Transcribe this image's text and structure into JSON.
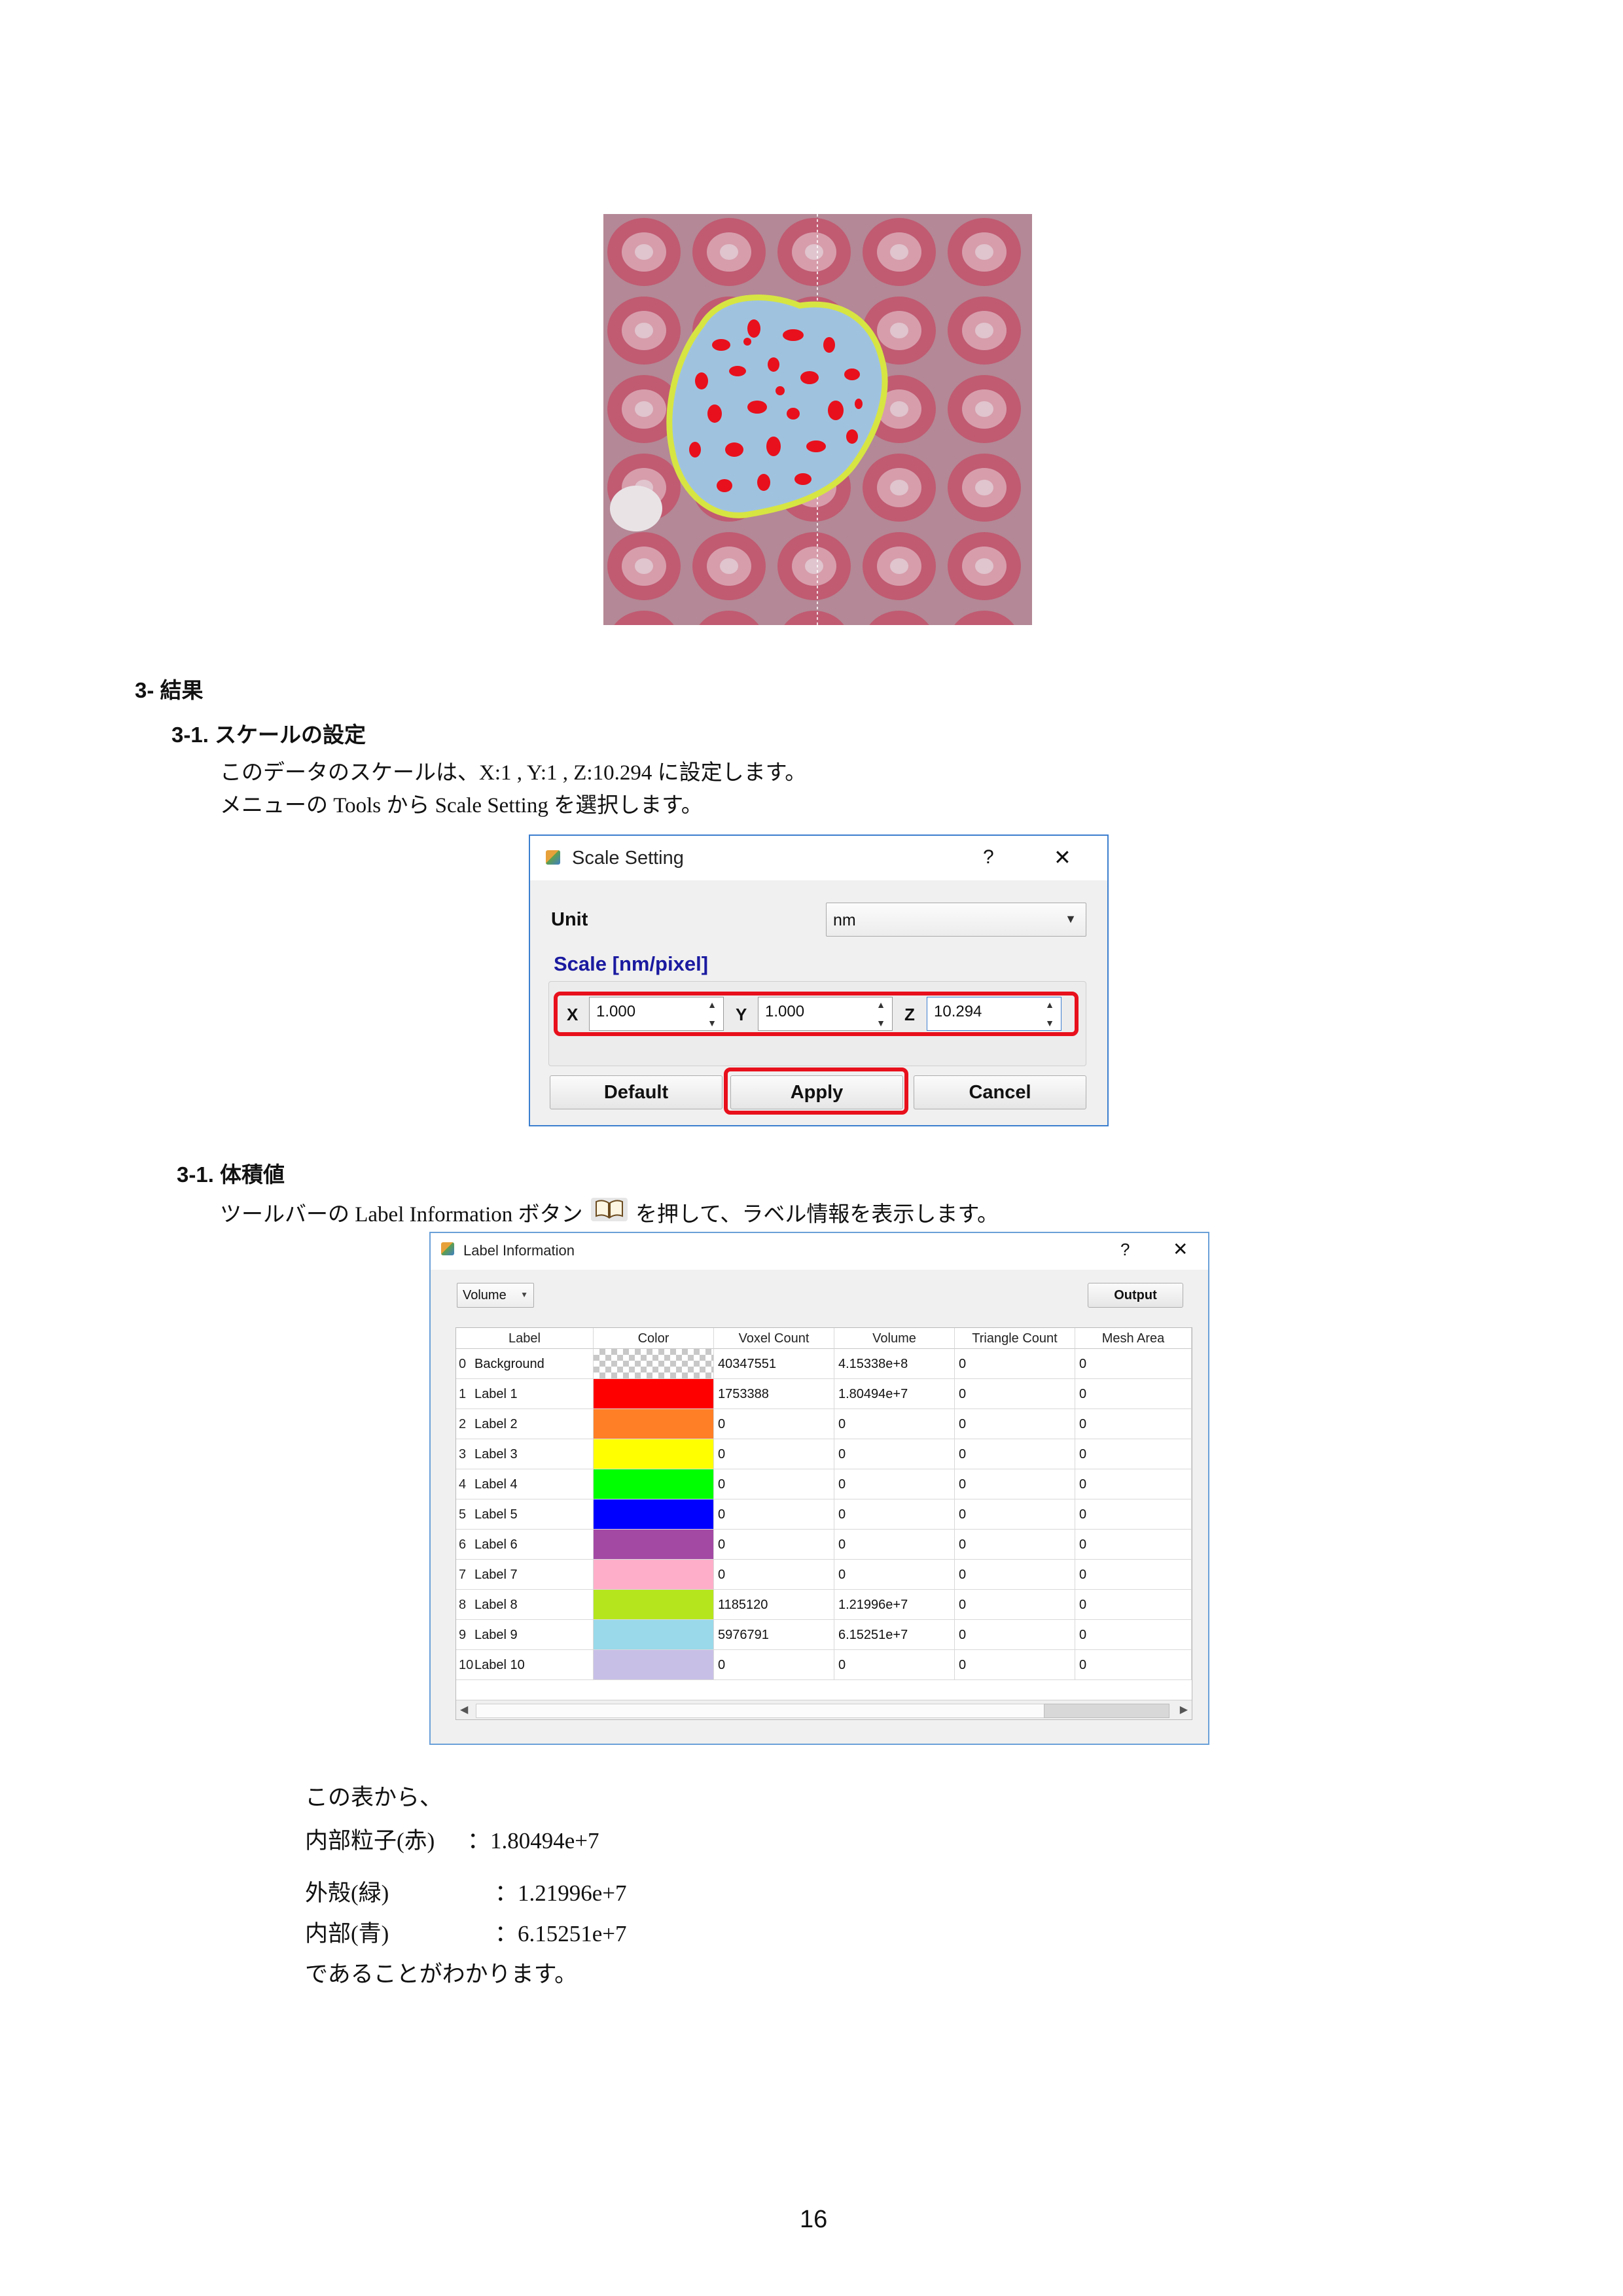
{
  "section3": {
    "heading": "3- 結果",
    "sub1_heading": "3-1. スケールの設定",
    "sub1_line1": "このデータのスケールは、X:1 , Y:1 , Z:10.294 に設定します。",
    "sub1_line2": "メニューの Tools から Scale Setting を選択します。",
    "sub2_heading": "3-1. 体積値",
    "sub2_line_before": "ツールバーの Label Information ボタン",
    "sub2_line_after": "を押して、ラベル情報を表示します。",
    "toolbar_icon": "book-icon"
  },
  "scale_dialog": {
    "title": "Scale Setting",
    "help": "?",
    "close": "✕",
    "unit_label": "Unit",
    "unit_value": "nm",
    "scale_heading": "Scale [nm/pixel]",
    "x_label": "X",
    "x_value": "1.000",
    "y_label": "Y",
    "y_value": "1.000",
    "z_label": "Z",
    "z_value": "10.294",
    "default_btn": "Default",
    "apply_btn": "Apply",
    "cancel_btn": "Cancel",
    "highlight_color": "#e8101c"
  },
  "label_dialog": {
    "title": "Label Information",
    "help": "?",
    "close": "✕",
    "dropdown_value": "Volume",
    "output_btn": "Output",
    "columns": [
      "Label",
      "Color",
      "Voxel Count",
      "Volume",
      "Triangle Count",
      "Mesh Area"
    ],
    "rows": [
      {
        "idx": "0",
        "label": "Background",
        "color": "checker",
        "voxels": "40347551",
        "volume": "4.15338e+8",
        "tri": "0",
        "mesh": "0"
      },
      {
        "idx": "1",
        "label": "Label 1",
        "color": "#ff0000",
        "voxels": "1753388",
        "volume": "1.80494e+7",
        "tri": "0",
        "mesh": "0"
      },
      {
        "idx": "2",
        "label": "Label 2",
        "color": "#ff7f27",
        "voxels": "0",
        "volume": "0",
        "tri": "0",
        "mesh": "0"
      },
      {
        "idx": "3",
        "label": "Label 3",
        "color": "#ffff00",
        "voxels": "0",
        "volume": "0",
        "tri": "0",
        "mesh": "0"
      },
      {
        "idx": "4",
        "label": "Label 4",
        "color": "#00ff00",
        "voxels": "0",
        "volume": "0",
        "tri": "0",
        "mesh": "0"
      },
      {
        "idx": "5",
        "label": "Label 5",
        "color": "#0000ff",
        "voxels": "0",
        "volume": "0",
        "tri": "0",
        "mesh": "0"
      },
      {
        "idx": "6",
        "label": "Label 6",
        "color": "#a349a4",
        "voxels": "0",
        "volume": "0",
        "tri": "0",
        "mesh": "0"
      },
      {
        "idx": "7",
        "label": "Label 7",
        "color": "#ffaec9",
        "voxels": "0",
        "volume": "0",
        "tri": "0",
        "mesh": "0"
      },
      {
        "idx": "8",
        "label": "Label 8",
        "color": "#b5e61d",
        "voxels": "1185120",
        "volume": "1.21996e+7",
        "tri": "0",
        "mesh": "0"
      },
      {
        "idx": "9",
        "label": "Label 9",
        "color": "#99d9ea",
        "voxels": "5976791",
        "volume": "6.15251e+7",
        "tri": "0",
        "mesh": "0"
      },
      {
        "idx": "10",
        "label": "Label 10",
        "color": "#c8bfe7",
        "voxels": "0",
        "volume": "0",
        "tri": "0",
        "mesh": "0"
      }
    ]
  },
  "results": {
    "intro": "この表から、",
    "line1_label": "内部粒子(赤)",
    "line1_value": "：1.80494e+7",
    "line2_label": "外殻(緑)",
    "line2_value": "：1.21996e+7",
    "line3_label": "内部(青)",
    "line3_value": "：6.15251e+7",
    "outro": "であることがわかります。"
  },
  "page_number": "16"
}
